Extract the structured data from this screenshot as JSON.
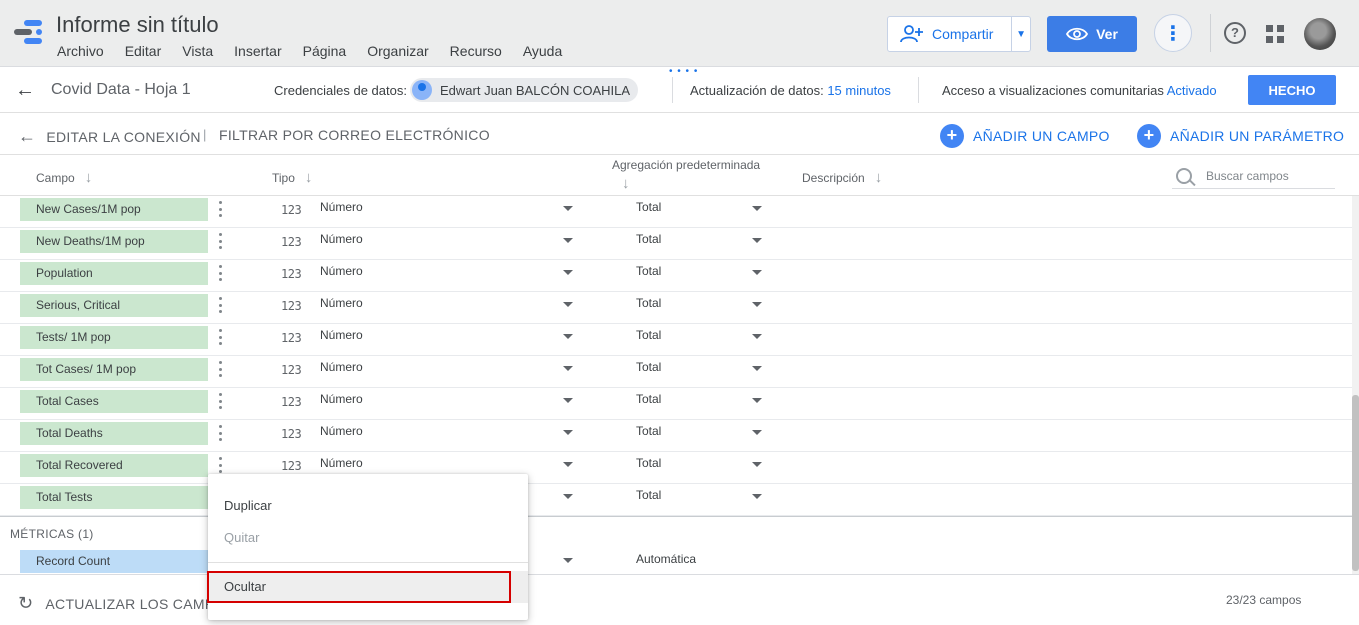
{
  "app": {
    "title": "Informe sin título",
    "menu": [
      "Archivo",
      "Editar",
      "Vista",
      "Insertar",
      "Página",
      "Organizar",
      "Recurso",
      "Ayuda"
    ],
    "share_label": "Compartir",
    "view_label": "Ver"
  },
  "datasource": {
    "name": "Covid Data - Hoja 1",
    "credentials_label": "Credenciales de datos:",
    "credentials_user": "Edwart Juan BALCÓN COAHILA",
    "refresh_label": "Actualización de datos:",
    "refresh_value": "15 minutos",
    "community_label": "Acceso a visualizaciones comunitarias",
    "community_value": "Activado",
    "done_label": "HECHO"
  },
  "toolbar": {
    "edit_connection": "EDITAR LA CONEXIÓN",
    "separator": "|",
    "filter_email": "FILTRAR POR CORREO ELECTRÓNICO",
    "add_field": "AÑADIR UN CAMPO",
    "add_parameter": "AÑADIR UN PARÁMETRO"
  },
  "columns": {
    "field": "Campo",
    "type": "Tipo",
    "aggregation": "Agregación predeterminada",
    "description": "Descripción",
    "search_placeholder": "Buscar campos"
  },
  "dimension_rows": [
    {
      "name": "New Cases/1M pop",
      "type_icon": "123",
      "type": "Número",
      "aggregation": "Total"
    },
    {
      "name": "New Deaths/1M pop",
      "type_icon": "123",
      "type": "Número",
      "aggregation": "Total"
    },
    {
      "name": "Population",
      "type_icon": "123",
      "type": "Número",
      "aggregation": "Total"
    },
    {
      "name": "Serious, Critical",
      "type_icon": "123",
      "type": "Número",
      "aggregation": "Total"
    },
    {
      "name": "Tests/ 1M pop",
      "type_icon": "123",
      "type": "Número",
      "aggregation": "Total"
    },
    {
      "name": "Tot Cases/ 1M pop",
      "type_icon": "123",
      "type": "Número",
      "aggregation": "Total"
    },
    {
      "name": "Total Cases",
      "type_icon": "123",
      "type": "Número",
      "aggregation": "Total"
    },
    {
      "name": "Total Deaths",
      "type_icon": "123",
      "type": "Número",
      "aggregation": "Total"
    },
    {
      "name": "Total Recovered",
      "type_icon": "123",
      "type": "Número",
      "aggregation": "Total"
    },
    {
      "name": "Total Tests",
      "type_icon": "",
      "type": "",
      "aggregation": "Total"
    }
  ],
  "metrics": {
    "header": "MÉTRICAS (1)",
    "rows": [
      {
        "name": "Record Count",
        "aggregation": "Automática"
      }
    ]
  },
  "footer": {
    "refresh_fields": "ACTUALIZAR LOS CAMPOS",
    "field_count": "23/23 campos"
  },
  "context_menu": {
    "duplicate": "Duplicar",
    "remove": "Quitar",
    "hide": "Ocultar"
  },
  "colors": {
    "dimension_chip": "#cbe7cf",
    "metric_chip": "#bddcf7",
    "accent": "#1a73e8",
    "highlight": "#d50000"
  }
}
